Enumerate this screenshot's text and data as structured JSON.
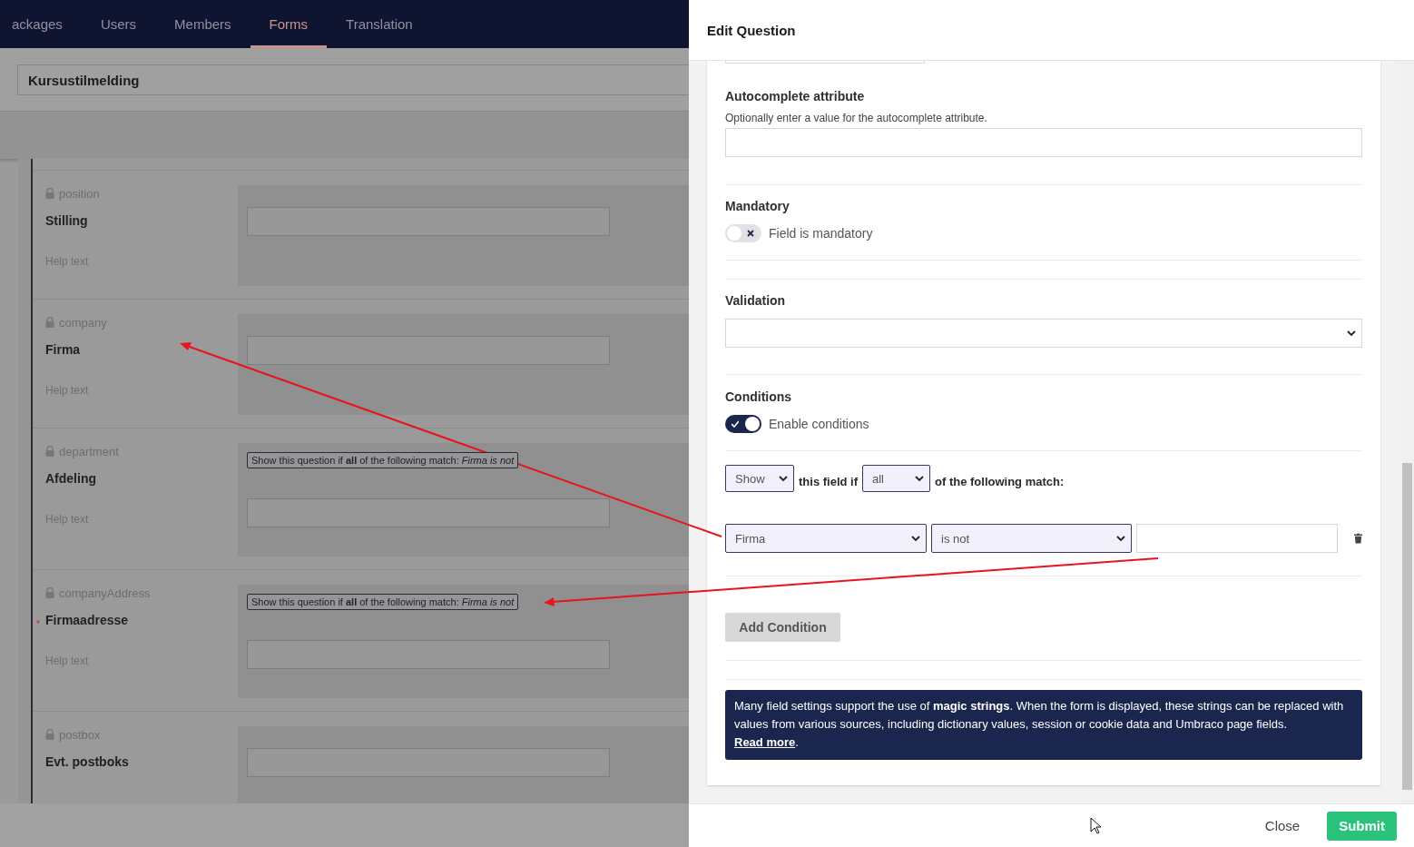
{
  "nav": {
    "tabs": [
      {
        "label": "ackages",
        "selected": false
      },
      {
        "label": "Users",
        "selected": false
      },
      {
        "label": "Members",
        "selected": false
      },
      {
        "label": "Forms",
        "selected": true
      },
      {
        "label": "Translation",
        "selected": false
      }
    ]
  },
  "form_title": "Kursustilmelding",
  "questions": [
    {
      "alias": "position",
      "label": "Stilling",
      "help_text": "Help text"
    },
    {
      "alias": "company",
      "label": "Firma",
      "help_text": "Help text"
    },
    {
      "alias": "department",
      "label": "Afdeling",
      "help_text": "Help text",
      "condition_note": "Show this question if **all** of the following match: *Firma is not*"
    },
    {
      "alias": "companyAddress",
      "label": "Firmaadresse",
      "help_text": "Help text",
      "required_mark": "*",
      "condition_note": "Show this question if **all** of the following match: *Firma is not*"
    },
    {
      "alias": "postbox",
      "label": "Evt. postboks"
    }
  ],
  "panel": {
    "title": "Edit Question",
    "autocomplete": {
      "label": "Autocomplete attribute",
      "description": "Optionally enter a value for the autocomplete attribute."
    },
    "mandatory": {
      "label": "Mandatory",
      "toggle_label": "Field is mandatory",
      "on": false
    },
    "validation": {
      "label": "Validation"
    },
    "conditions": {
      "label": "Conditions",
      "toggle_label": "Enable conditions",
      "on": true,
      "action": "Show",
      "connector": "this field if",
      "logic": "all",
      "suffix": "of the following match:",
      "rules": [
        {
          "field": "Firma",
          "operator": "is not"
        }
      ]
    },
    "add_condition": "Add Condition",
    "info": {
      "text": "Many field settings support the use of **magic strings**. When the form is displayed, these strings can be replaced with values from various sources, including dictionary values, session or cookie data and Umbraco page fields.",
      "link": "Read more",
      "suffix": "."
    },
    "buttons": {
      "close": "Close",
      "submit": "Submit"
    }
  }
}
